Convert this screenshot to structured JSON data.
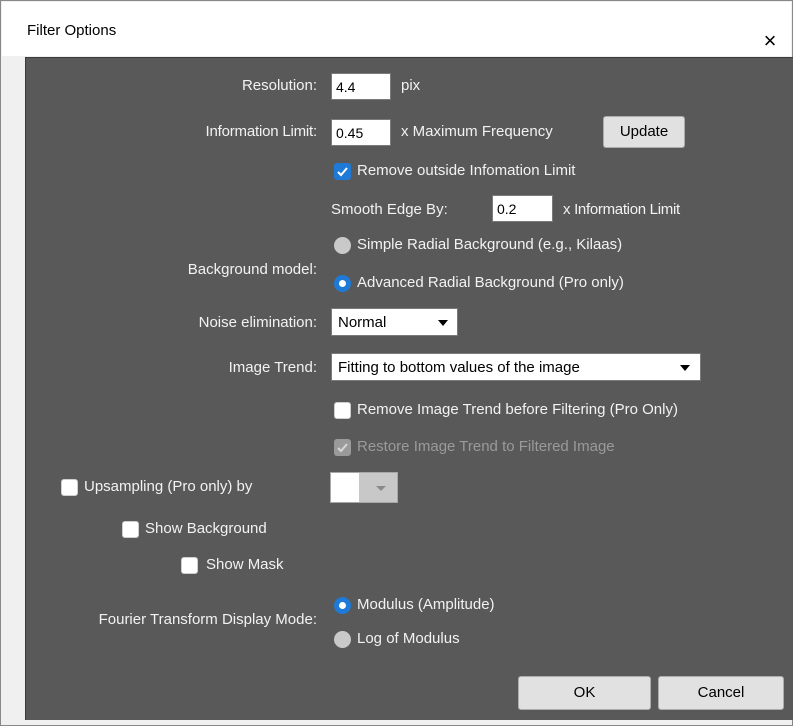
{
  "window": {
    "title": "Filter Options",
    "close_icon": "×"
  },
  "resolution": {
    "label": "Resolution:",
    "value": "4.4",
    "unit": "pix"
  },
  "info_limit": {
    "label": "Information Limit:",
    "value": "0.45",
    "unit": "x Maximum Frequency",
    "update_label": "Update"
  },
  "remove_outside": {
    "label": "Remove outside Infomation Limit",
    "checked": true
  },
  "smooth_edge": {
    "label": "Smooth Edge By:",
    "value": "0.2",
    "unit": "x Information Limit"
  },
  "background_model": {
    "label": "Background model:",
    "options": [
      {
        "label": "Simple Radial Background (e.g., Kilaas)",
        "selected": false
      },
      {
        "label": "Advanced Radial Background (Pro only)",
        "selected": true
      }
    ]
  },
  "noise": {
    "label": "Noise elimination:",
    "value": "Normal"
  },
  "image_trend": {
    "label": "Image Trend:",
    "value": "Fitting to bottom values of the image"
  },
  "remove_trend": {
    "label": "Remove Image Trend before Filtering (Pro Only)",
    "checked": false
  },
  "restore_trend": {
    "label": "Restore Image Trend to Filtered Image",
    "checked": true,
    "disabled": true
  },
  "upsampling": {
    "label": "Upsampling (Pro only) by",
    "checked": false
  },
  "show_background": {
    "label": "Show Background",
    "checked": false
  },
  "show_mask": {
    "label": "Show Mask",
    "checked": false
  },
  "fourier": {
    "label": "Fourier Transform  Display Mode:",
    "options": [
      {
        "label": "Modulus (Amplitude)",
        "selected": true
      },
      {
        "label": "Log of Modulus",
        "selected": false
      }
    ]
  },
  "buttons": {
    "ok": "OK",
    "cancel": "Cancel"
  },
  "colors": {
    "panel": "#595959",
    "accent": "#1e7ad6",
    "text": "#f2f2f2"
  }
}
